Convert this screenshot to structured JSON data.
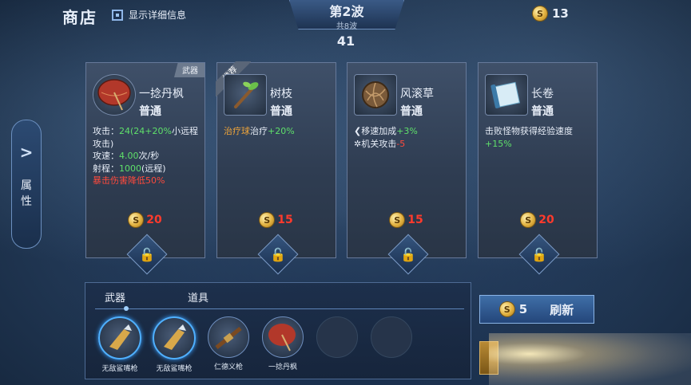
{
  "header": {
    "shop_title": "商店",
    "detail_checkbox_label": "显示详细信息",
    "wave_title": "第2波",
    "wave_sub": "共8波",
    "timer": "41",
    "gold": "13"
  },
  "side_tab": {
    "label_1": "属",
    "label_2": "性"
  },
  "cards": [
    {
      "name": "一捻丹枫",
      "rarity": "普通",
      "tag": "武器",
      "price": "20",
      "desc": {
        "l1a": "攻击：",
        "l1b": "24",
        "l1c": "(24+",
        "l1d": "20%",
        "l1e": "小远程攻击)",
        "l2a": "攻速：",
        "l2b": "4.00",
        "l2c": "次/秒",
        "l3a": "射程：",
        "l3b": "1000",
        "l3c": "(远程)",
        "l4": "暴击伤害降低50%"
      }
    },
    {
      "name": "树枝",
      "rarity": "普通",
      "ribbon": "推荐",
      "price": "15",
      "desc": {
        "a": "治疗球",
        "b": "治疗",
        "c": "+20%"
      }
    },
    {
      "name": "风滚草",
      "rarity": "普通",
      "price": "15",
      "desc": {
        "l1a": "移速加成",
        "l1b": "+3%",
        "l2a": "机关攻击",
        "l2b": "-5"
      }
    },
    {
      "name": "长卷",
      "rarity": "普通",
      "price": "20",
      "desc": {
        "a": "击败怪物获得经验速度",
        "b": "+15%"
      }
    }
  ],
  "inventory": {
    "tab_weapons": "武器",
    "tab_items": "道具",
    "slots": [
      {
        "name": "无敌鲨嘴枪"
      },
      {
        "name": "无敌鲨嘴枪"
      },
      {
        "name": "仁德义枪"
      },
      {
        "name": "一捻丹枫"
      }
    ]
  },
  "refresh": {
    "cost": "5",
    "label": "刷新"
  },
  "coin_glyph": "S",
  "lock_glyph": "🔓"
}
